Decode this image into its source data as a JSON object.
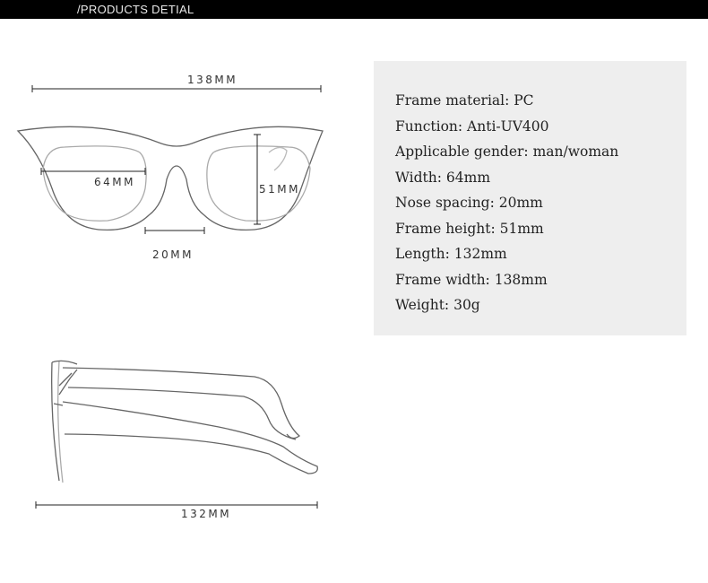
{
  "header": {
    "title": "/PRODUCTS DETIAL"
  },
  "front_view": {
    "total_width_label": "138MM",
    "lens_width_label": "64MM",
    "lens_height_label": "51MM",
    "bridge_label": "20MM"
  },
  "side_view": {
    "temple_length_label": "132MM"
  },
  "specs": [
    "Frame material: PC",
    "Function: Anti-UV400",
    "Applicable gender: man/woman",
    "Width: 64mm",
    "Nose spacing: 20mm",
    "Frame height: 51mm",
    "Length: 132mm",
    "Frame width: 138mm",
    "Weight: 30g"
  ],
  "colors": {
    "header_bg": "#000000",
    "header_text": "#e8e8e8",
    "spec_panel_bg": "#eeeeee",
    "line": "#222222"
  }
}
